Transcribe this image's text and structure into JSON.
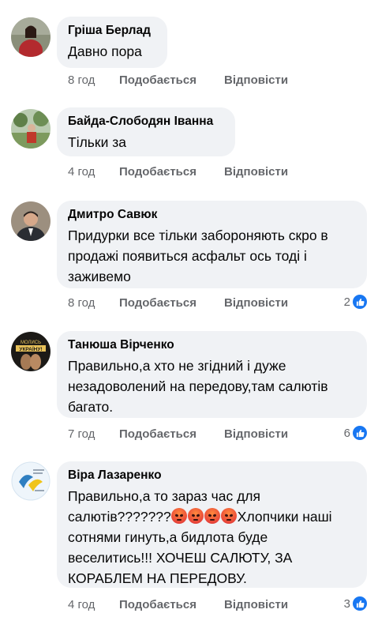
{
  "comments": [
    {
      "author": "Гріша Берлад",
      "text": "Давно пора",
      "time": "8 год",
      "like": "Подобається",
      "reply": "Відповісти"
    },
    {
      "author": "Байда-Слободян Іванна",
      "text": "Тільки за",
      "time": "4 год",
      "like": "Подобається",
      "reply": "Відповісти"
    },
    {
      "author": "Дмитро Савюк",
      "text": "Придурки все тільки забороняють скро в продажі появиться асфальт ось тоді і заживемо",
      "time": "8 год",
      "like": "Подобається",
      "reply": "Відповісти",
      "reaction_count": "2"
    },
    {
      "author": "Танюша Вірченко",
      "text": "Правильно,а хто не згідний і дуже незадоволений на передову,там салютів багато.",
      "time": "7 год",
      "like": "Подобається",
      "reply": "Відповісти",
      "reaction_count": "6"
    },
    {
      "author": "Віра Лазаренко",
      "text_part1": "Правильно,а то  зараз час для салютів???????",
      "text_part2": "Хлопчики наші сотнями гинуть,а бидлота буде веселитись!!! ХОЧЕШ САЛЮТУ, ЗА КОРАБЛЕМ НА ПЕРЕДОВУ.",
      "time": "4 год",
      "like": "Подобається",
      "reply": "Відповісти",
      "reaction_count": "3"
    }
  ],
  "colors": {
    "bubble": "#f0f2f5",
    "meta_text": "#65676b",
    "like_blue": "#1877f2"
  },
  "icons": {
    "reaction": "like-thumb-icon",
    "emoji": "angry-face-icon"
  }
}
